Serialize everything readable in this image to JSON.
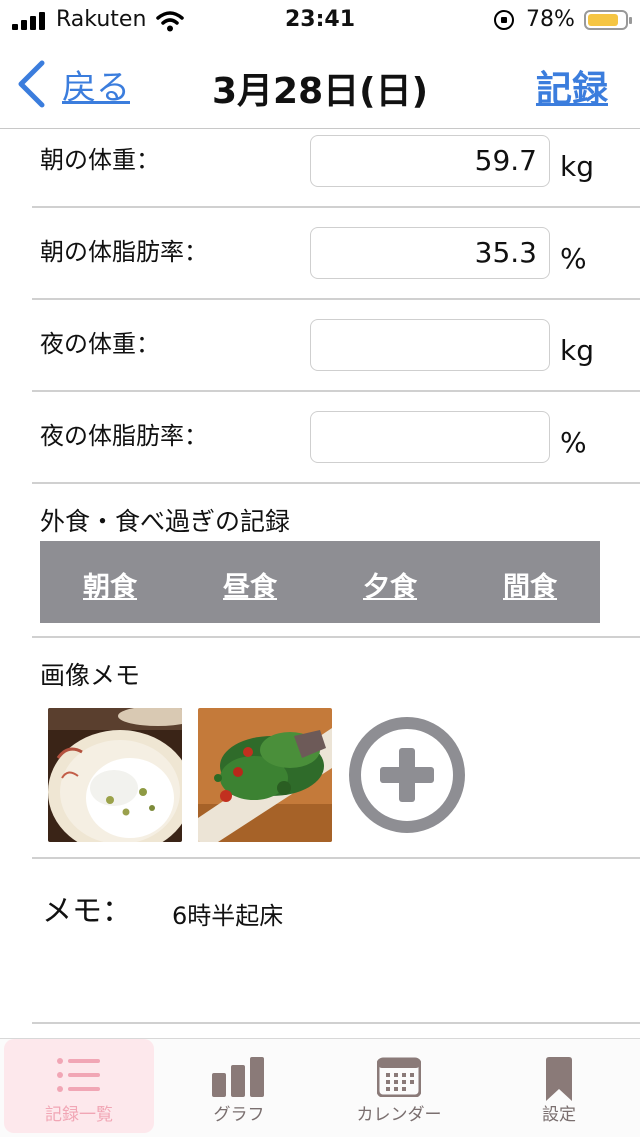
{
  "status_bar": {
    "carrier": "Rakuten",
    "time": "23:41",
    "battery_percent": "78%"
  },
  "nav": {
    "back_label": "戻る",
    "title": "3月28日(日)",
    "save_label": "記録"
  },
  "form": {
    "morning_weight": {
      "label": "朝の体重：",
      "value": "59.7",
      "unit": "kg"
    },
    "morning_body_fat": {
      "label": "朝の体脂肪率：",
      "value": "35.3",
      "unit": "%"
    },
    "evening_weight": {
      "label": "夜の体重：",
      "value": "",
      "unit": "kg"
    },
    "evening_body_fat": {
      "label": "夜の体脂肪率：",
      "value": "",
      "unit": "%"
    }
  },
  "meals": {
    "section_title": "外食・食べ過ぎの記録",
    "buttons": [
      "朝食",
      "昼食",
      "夕食",
      "間食"
    ]
  },
  "image_memo": {
    "section_title": "画像メモ"
  },
  "memo": {
    "label": "メモ：",
    "text": "6時半起床"
  },
  "tabs": [
    {
      "label": "記録一覧",
      "icon": "list-icon",
      "active": true
    },
    {
      "label": "グラフ",
      "icon": "bar-chart-icon",
      "active": false
    },
    {
      "label": "カレンダー",
      "icon": "calendar-icon",
      "active": false
    },
    {
      "label": "設定",
      "icon": "bookmark-icon",
      "active": false
    }
  ],
  "colors": {
    "accent": "#3b7ddd",
    "meal_bar": "#8e8e93",
    "active_tab": "#f1a6b5",
    "battery": "#f5c542"
  }
}
